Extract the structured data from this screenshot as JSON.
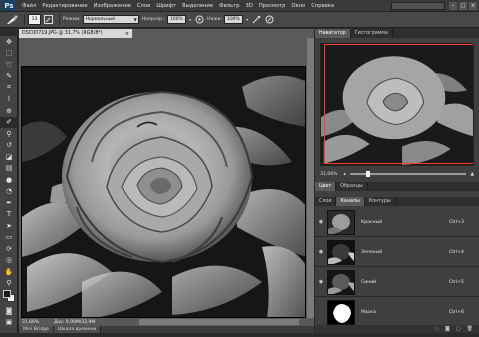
{
  "app": {
    "logo": "Ps"
  },
  "menu": [
    "Файл",
    "Редактирование",
    "Изображение",
    "Слои",
    "Шрифт",
    "Выделение",
    "Фильтр",
    "3D",
    "Просмотр",
    "Окно",
    "Справка"
  ],
  "window_controls": {
    "workspace": "",
    "minimize": "–",
    "maximize": "□",
    "close": "×"
  },
  "options": {
    "brush_size": "13",
    "mode_label": "Режим:",
    "mode_value": "Нормальный",
    "opacity_label": "Непрозр.:",
    "opacity_value": "100%",
    "pressure_label": "Нажи:",
    "pressure_value": "100%"
  },
  "document": {
    "tab_title": "DSC00719.JPG @ 31,7% (RGB/8*)",
    "close": "×",
    "zoom": "31,66%",
    "doc_size": "Док: 9,00M/32,9M"
  },
  "bottom_tabs": [
    "Mini Bridge",
    "Шкала времени"
  ],
  "navigator": {
    "tabs": [
      "Навигатор",
      "Гистограмма"
    ],
    "zoom": "31,66%"
  },
  "color_tabs": [
    "Цвет",
    "Образцы"
  ],
  "channels": {
    "tabs": [
      "Слои",
      "Каналы",
      "Контуры"
    ],
    "rows": [
      {
        "name": "Красный",
        "key": "Ctrl+3"
      },
      {
        "name": "Зеленый",
        "key": "Ctrl+4"
      },
      {
        "name": "Синий",
        "key": "Ctrl+5"
      },
      {
        "name": "Маска",
        "key": "Ctrl+6"
      }
    ]
  },
  "icons": {
    "eye": "eye-icon",
    "dropdown": "chevron-down-icon",
    "brush": "brush-icon"
  }
}
